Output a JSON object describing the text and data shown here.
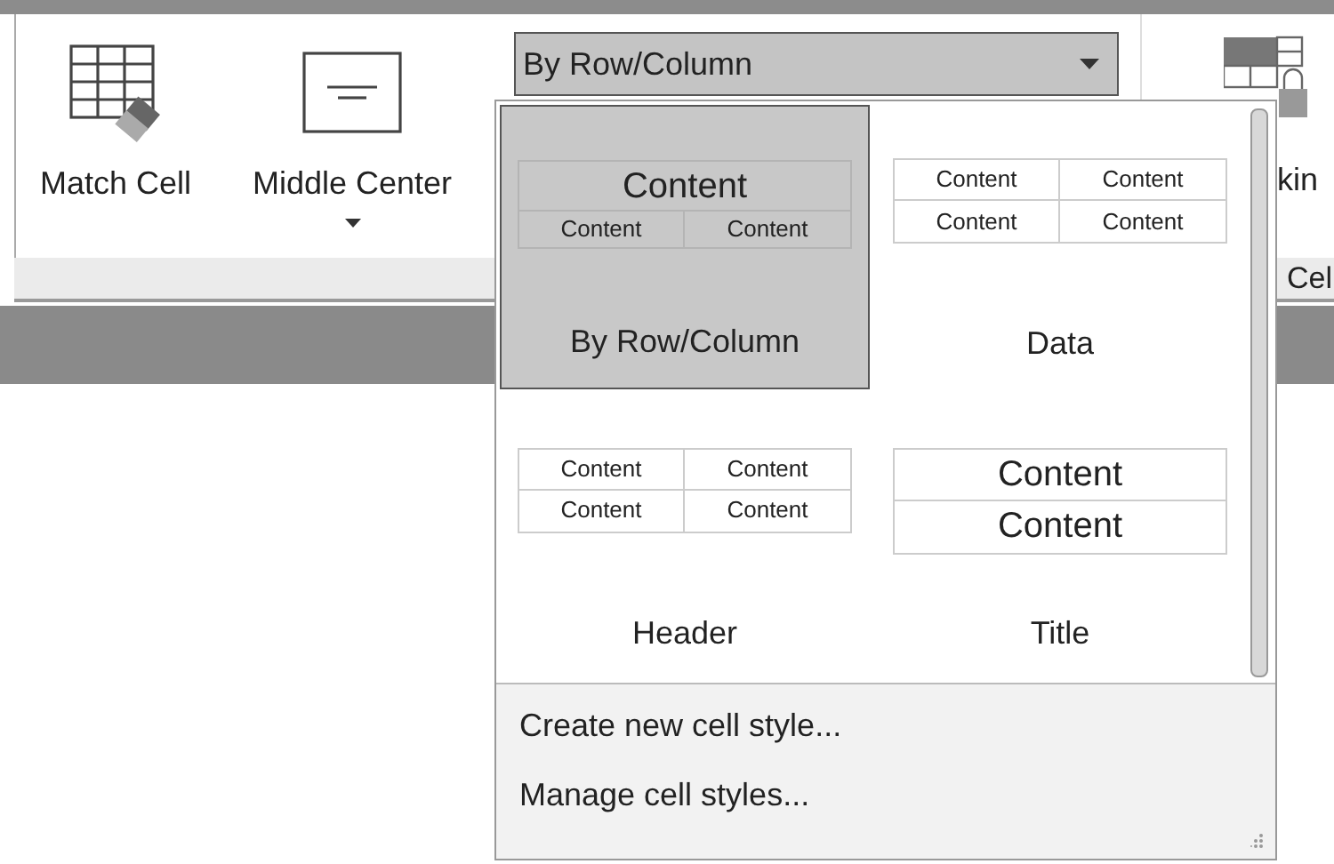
{
  "ribbon": {
    "buttons": [
      {
        "kind": "match",
        "label": "Match Cell",
        "has_menu": false
      },
      {
        "kind": "align",
        "label": "Middle Center",
        "has_menu": true
      }
    ],
    "combo": {
      "value": "By Row/Column",
      "expanded": true
    },
    "right_button": {
      "label": "kin"
    },
    "group_label": "Cel"
  },
  "gallery": {
    "styles": [
      {
        "kind": "row_column",
        "label": "By Row/Column",
        "selected": true,
        "cells": [
          "Content",
          "Content",
          "Content"
        ]
      },
      {
        "kind": "data",
        "label": "Data",
        "selected": false,
        "cells": [
          "Content",
          "Content",
          "Content",
          "Content"
        ]
      },
      {
        "kind": "header",
        "label": "Header",
        "selected": false,
        "cells": [
          "Content",
          "Content",
          "Content",
          "Content"
        ]
      },
      {
        "kind": "title",
        "label": "Title",
        "selected": false,
        "cells": [
          "Content",
          "Content"
        ]
      }
    ],
    "actions": [
      "Create new cell style...",
      "Manage cell styles..."
    ]
  }
}
